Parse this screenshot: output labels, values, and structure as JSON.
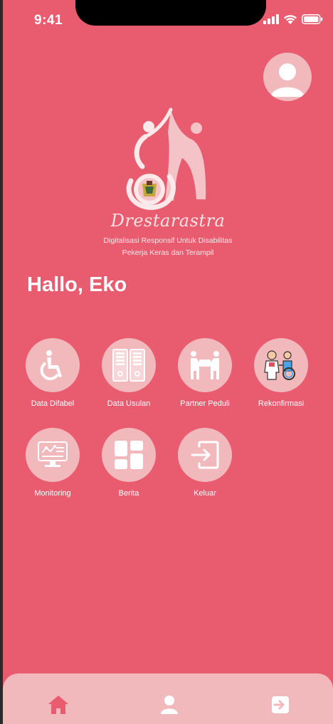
{
  "status": {
    "time": "9:41"
  },
  "brand": {
    "name": "Drestarastra",
    "tagline_line1": "Digitalisasi Responsif Untuk Disabilitas",
    "tagline_line2": "Pekerja Keras dan Terampil"
  },
  "greeting": "Hallo, Eko",
  "menu": [
    {
      "label": "Data Difabel",
      "icon": "wheelchair-icon"
    },
    {
      "label": "Data Usulan",
      "icon": "filing-cabinet-icon"
    },
    {
      "label": "Partner Peduli",
      "icon": "partner-icon"
    },
    {
      "label": "Rekonfirmasi",
      "icon": "caregiver-icon"
    },
    {
      "label": "Monitoring",
      "icon": "monitor-icon"
    },
    {
      "label": "Berita",
      "icon": "dashboard-icon"
    },
    {
      "label": "Keluar",
      "icon": "login-icon"
    }
  ],
  "bottom_nav": [
    {
      "name": "home",
      "icon": "home-icon",
      "active": true
    },
    {
      "name": "profile",
      "icon": "user-icon",
      "active": false
    },
    {
      "name": "logout",
      "icon": "logout-icon",
      "active": false
    }
  ],
  "colors": {
    "background": "#e95b6f",
    "circle": "#f2b9bd",
    "accent": "#e95b6f",
    "text": "#ffffff"
  }
}
